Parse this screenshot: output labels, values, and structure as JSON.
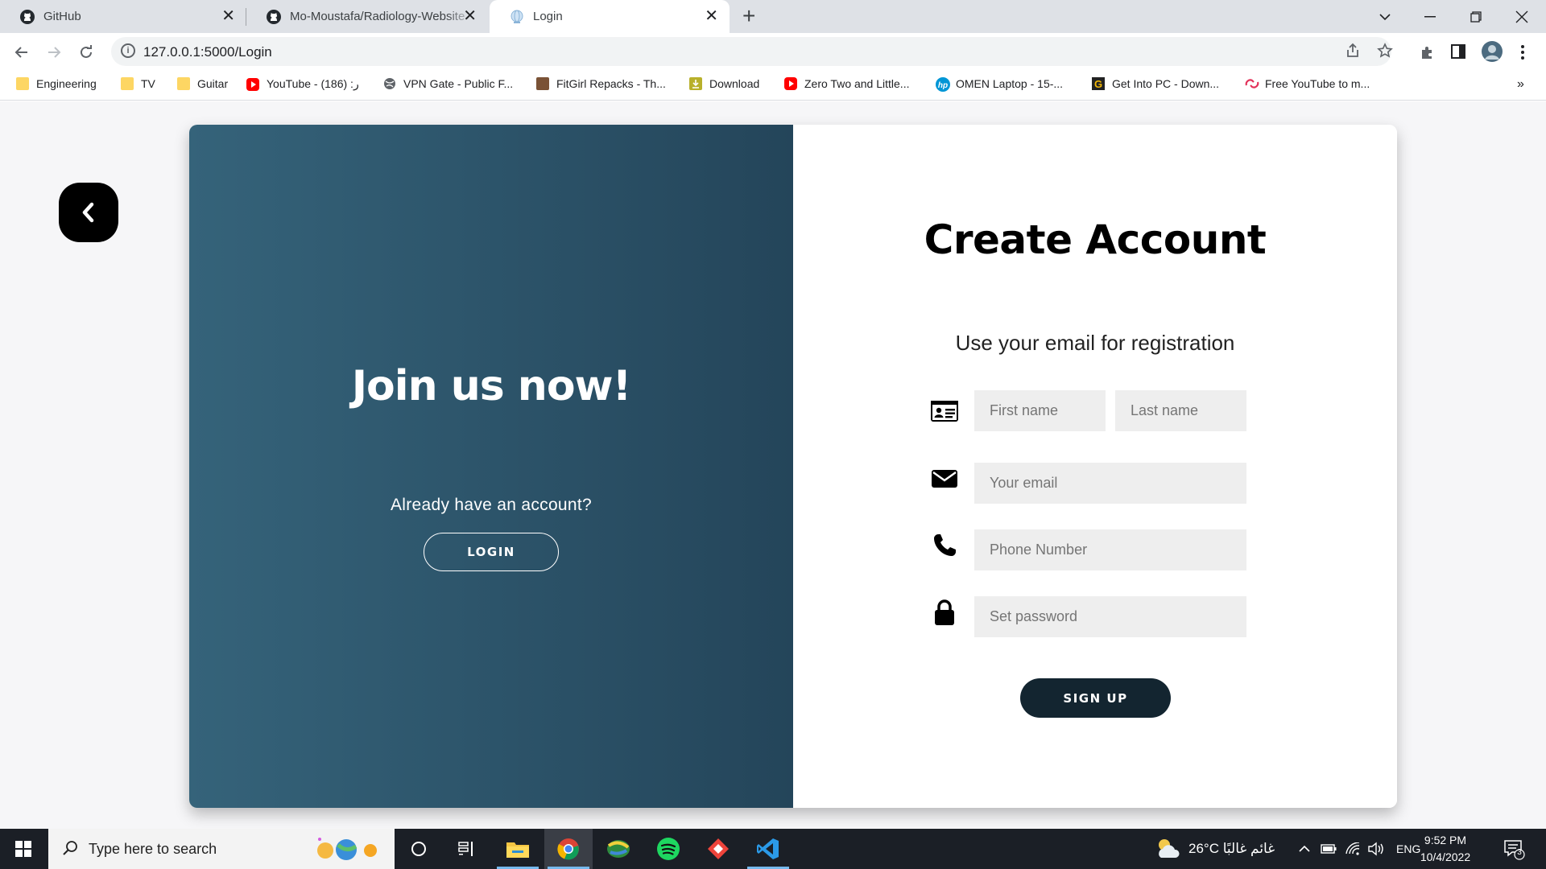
{
  "browser": {
    "tabs": [
      {
        "title": "GitHub",
        "active": false
      },
      {
        "title": "Mo-Moustafa/Radiology-Website",
        "active": false
      },
      {
        "title": "Login",
        "active": true
      }
    ],
    "url": "127.0.0.1:5000/Login",
    "bookmarks": [
      {
        "label": "Engineering",
        "icon": "folder-icon"
      },
      {
        "label": "TV",
        "icon": "folder-icon"
      },
      {
        "label": "Guitar",
        "icon": "folder-icon"
      },
      {
        "label": "YouTube - ر: (186)",
        "icon": "youtube-icon"
      },
      {
        "label": "VPN Gate - Public F...",
        "icon": "globe-icon"
      },
      {
        "label": "FitGirl Repacks - Th...",
        "icon": "fitgirl-icon"
      },
      {
        "label": "Download",
        "icon": "download-icon"
      },
      {
        "label": "Zero Two and Little...",
        "icon": "youtube-icon"
      },
      {
        "label": "OMEN Laptop - 15-...",
        "icon": "hp-icon"
      },
      {
        "label": "Get Into PC - Down...",
        "icon": "getintopc-icon"
      },
      {
        "label": "Free YouTube to m...",
        "icon": "converter-icon"
      }
    ],
    "more_bookmarks": "»"
  },
  "page": {
    "left": {
      "title": "Join us now!",
      "prompt": "Already have an account?",
      "login_label": "LOGIN"
    },
    "right": {
      "title": "Create Account",
      "subtitle": "Use your email for registration",
      "first_name_placeholder": "First name",
      "last_name_placeholder": "Last name",
      "email_placeholder": "Your email",
      "phone_placeholder": "Phone Number",
      "password_placeholder": "Set password",
      "signup_label": "SIGN UP"
    }
  },
  "taskbar": {
    "search_placeholder": "Type here to search",
    "weather": "26°C  غائم غالبًا",
    "language": "ENG",
    "time": "9:52 PM",
    "date": "10/4/2022",
    "notification_count": "3"
  }
}
